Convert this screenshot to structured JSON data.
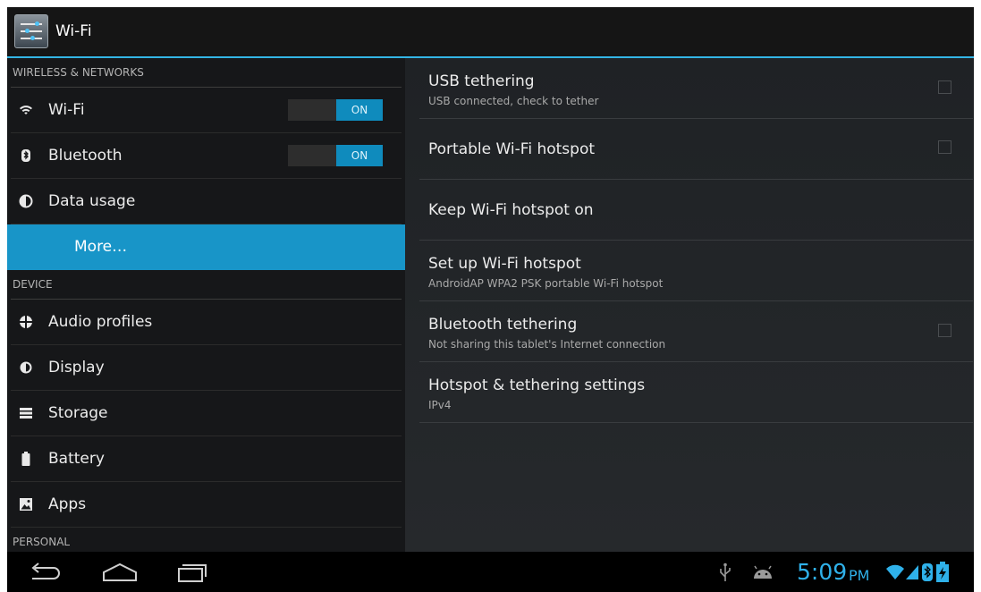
{
  "action_bar": {
    "title": "Wi-Fi",
    "icon": "settings-sliders-icon"
  },
  "headers": [
    {
      "type": "category",
      "label": "WIRELESS & NETWORKS"
    },
    {
      "type": "item",
      "label": "Wi-Fi",
      "icon": "wifi-icon",
      "toggle": "ON"
    },
    {
      "type": "item",
      "label": "Bluetooth",
      "icon": "bluetooth-icon",
      "toggle": "ON"
    },
    {
      "type": "item",
      "label": "Data usage",
      "icon": "data-usage-icon"
    },
    {
      "type": "item",
      "label": "More…",
      "selected": true
    },
    {
      "type": "category",
      "label": "DEVICE"
    },
    {
      "type": "item",
      "label": "Audio profiles",
      "icon": "audio-profiles-icon"
    },
    {
      "type": "item",
      "label": "Display",
      "icon": "display-icon"
    },
    {
      "type": "item",
      "label": "Storage",
      "icon": "storage-icon"
    },
    {
      "type": "item",
      "label": "Battery",
      "icon": "battery-icon"
    },
    {
      "type": "item",
      "label": "Apps",
      "icon": "apps-icon"
    },
    {
      "type": "category",
      "label": "PERSONAL"
    }
  ],
  "prefs": [
    {
      "title": "USB tethering",
      "summary": "USB connected, check to tether",
      "checkbox": true,
      "checked": false
    },
    {
      "title": "Portable Wi-Fi hotspot",
      "summary": "",
      "checkbox": true,
      "checked": false
    },
    {
      "title": "Keep Wi-Fi hotspot on",
      "summary": "",
      "checkbox": false
    },
    {
      "title": "Set up Wi-Fi hotspot",
      "summary": "AndroidAP WPA2 PSK portable Wi-Fi hotspot",
      "checkbox": false
    },
    {
      "title": "Bluetooth tethering",
      "summary": "Not sharing this tablet's Internet connection",
      "checkbox": true,
      "checked": false
    },
    {
      "title": "Hotspot & tethering settings",
      "summary": "IPv4",
      "checkbox": false
    }
  ],
  "status_bar": {
    "time": "5:09",
    "ampm": "PM",
    "icons": [
      "usb-icon",
      "android-debug-icon",
      "wifi-signal-icon",
      "cell-signal-icon",
      "bluetooth-status-icon",
      "battery-charging-icon"
    ]
  },
  "nav_buttons": [
    "back-button",
    "home-button",
    "recent-apps-button"
  ],
  "colors": {
    "accent": "#33b5e5",
    "selected": "#1895c8",
    "clock": "#2fb1ea"
  }
}
